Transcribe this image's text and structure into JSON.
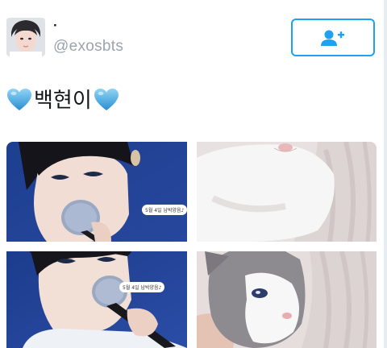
{
  "profile": {
    "display_name": "·",
    "username": "@exosbts"
  },
  "follow_button": {
    "icon": "follow-person-plus-icon",
    "color": "#1da1f2"
  },
  "tweet": {
    "text": "백현이",
    "leading_emoji": "blue-heart-icon",
    "trailing_emoji": "blue-heart-icon"
  },
  "media": {
    "photos": [
      {
        "subject": "singer-with-microphone",
        "caption": "5월 4일 남박양음♪"
      },
      {
        "subject": "white-cat-closeup"
      },
      {
        "subject": "singer-with-microphone",
        "caption": "5월 4일 남박양음♪"
      },
      {
        "subject": "grey-white-cat-on-blanket"
      }
    ]
  },
  "colors": {
    "accent": "#1da1f2",
    "username_gray": "#9aa5ad",
    "text": "#14171a"
  }
}
